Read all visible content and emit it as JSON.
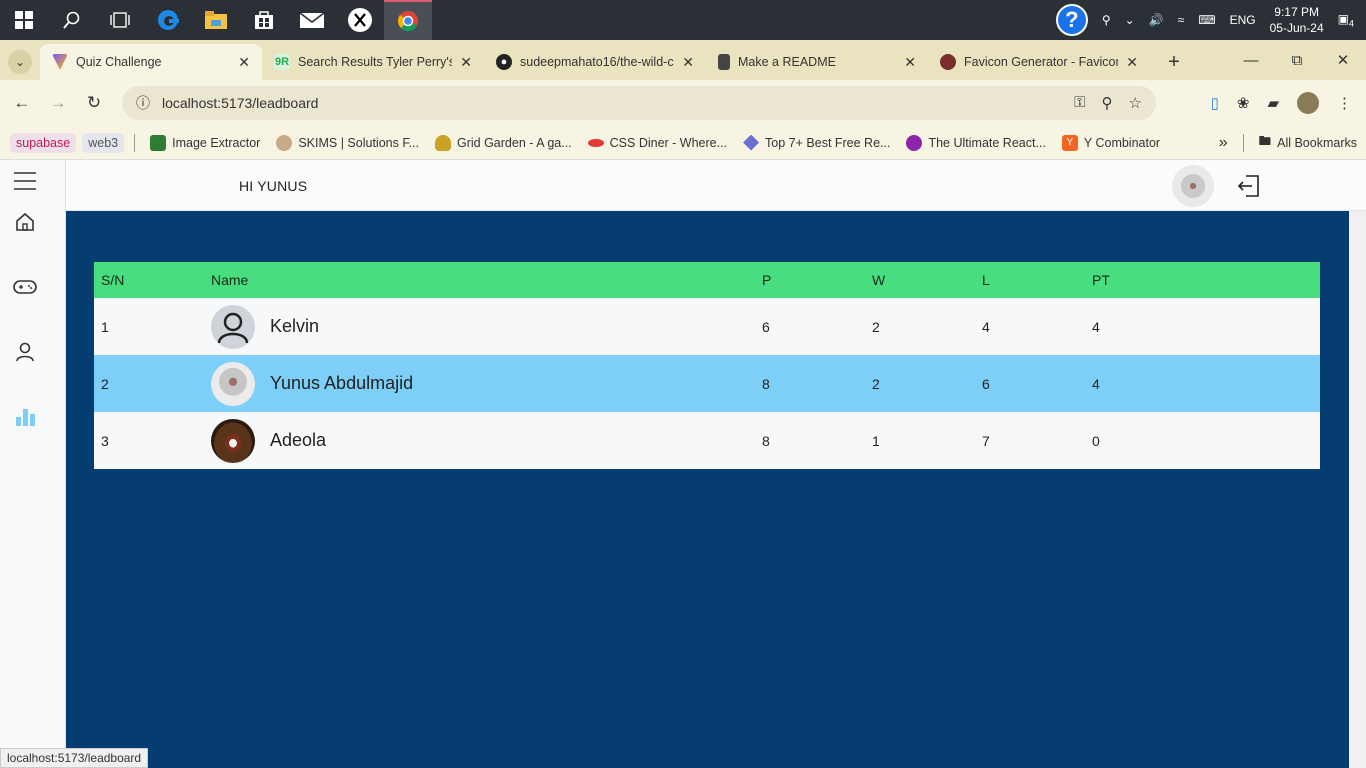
{
  "taskbar": {
    "time": "9:17 PM",
    "date": "05-Jun-24",
    "lang": "ENG",
    "notif_count": "4"
  },
  "browser": {
    "tabs": [
      {
        "title": "Quiz Challenge",
        "active": true
      },
      {
        "title": "Search Results Tyler Perry's S"
      },
      {
        "title": "sudeepmahato16/the-wild-c"
      },
      {
        "title": "Make a README"
      },
      {
        "title": "Favicon Generator - Favicon"
      }
    ],
    "url": "localhost:5173/leadboard",
    "bookmarks": [
      "supabase",
      "web3",
      "Image Extractor",
      "SKIMS | Solutions F...",
      "Grid Garden - A ga...",
      "CSS Diner - Where...",
      "Top 7+ Best Free Re...",
      "The Ultimate React...",
      "Y Combinator"
    ],
    "more": "»",
    "all_bookmarks": "All Bookmarks",
    "status_url": "localhost:5173/leadboard"
  },
  "header": {
    "greeting": "HI YUNUS"
  },
  "table": {
    "columns": [
      "S/N",
      "Name",
      "P",
      "W",
      "L",
      "PT"
    ],
    "rows": [
      {
        "sn": "1",
        "name": "Kelvin",
        "p": "6",
        "w": "2",
        "l": "4",
        "pt": "4"
      },
      {
        "sn": "2",
        "name": "Yunus Abdulmajid",
        "p": "8",
        "w": "2",
        "l": "6",
        "pt": "4"
      },
      {
        "sn": "3",
        "name": "Adeola",
        "p": "8",
        "w": "1",
        "l": "7",
        "pt": "0"
      }
    ]
  },
  "colors": {
    "main_bg": "#063d70",
    "header_row": "#48dd7e",
    "highlight_row": "#7ecff7",
    "active_nav": "#7ecff7"
  }
}
